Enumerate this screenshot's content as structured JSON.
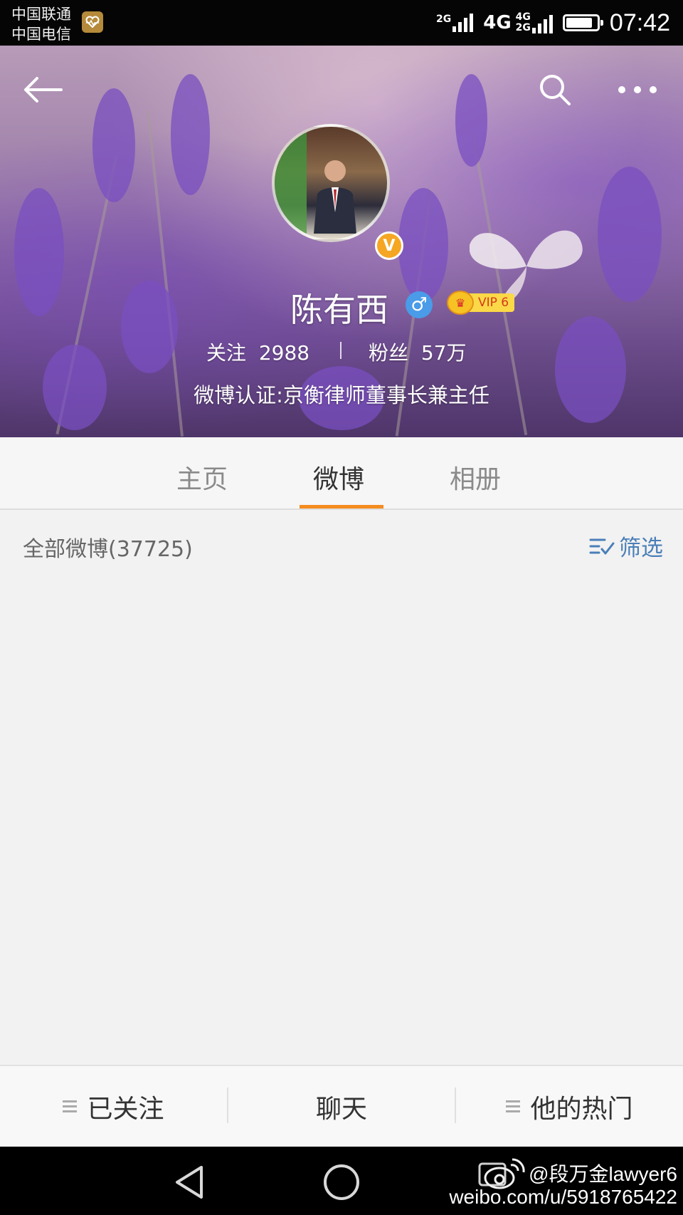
{
  "status_bar": {
    "carrier_1": "中国联通",
    "carrier_2": "中国电信",
    "net_1": "2G",
    "net_2": "4G",
    "net_3_top": "4G",
    "net_3_bottom": "2G",
    "battery_level": 0.85,
    "time": "07:42"
  },
  "profile": {
    "name": "陈有西",
    "gender_icon": "male-symbol-icon",
    "gender_glyph": "♂",
    "vip_label": "VIP 6",
    "verified_glyph": "V",
    "following_label": "关注",
    "following_count": "2988",
    "followers_label": "粉丝",
    "followers_count": "57万",
    "bio": "微博认证:京衡律师董事长兼主任"
  },
  "tabs": [
    {
      "label": "主页",
      "active": false
    },
    {
      "label": "微博",
      "active": true
    },
    {
      "label": "相册",
      "active": false
    }
  ],
  "list_header": {
    "count_label": "全部微博(37725)",
    "filter_label": "筛选"
  },
  "bottom_bar": {
    "follow_label": "已关注",
    "chat_label": "聊天",
    "hot_label": "他的热门"
  },
  "watermark": {
    "handle": "@段万金lawyer6",
    "url": "weibo.com/u/5918765422"
  },
  "colors": {
    "accent": "#f58c1f",
    "link": "#4a7fb8",
    "verified": "#f5a623",
    "gender": "#4a9be8"
  }
}
